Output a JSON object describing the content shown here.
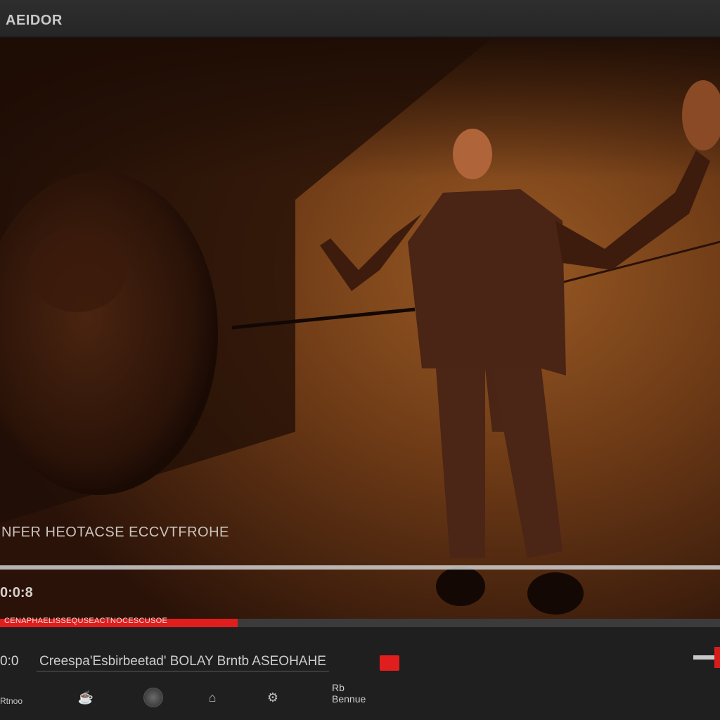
{
  "window": {
    "title": "AEIDOR"
  },
  "video": {
    "caption": "NFER HEOTACSE ECCVTFROHE",
    "elapsed": "0:0:8",
    "progress_percent": 33,
    "progress_label": "CENAPHAELISSEQUSEACTNOCESCUSOE"
  },
  "controls": {
    "left_label": "0:0",
    "title": "Creespa'Esbirbeetad' BOLAY Brntb ASEOHAHE",
    "bottom_label": "Rtnoo",
    "bottom_right_label": "Rb\nBennue",
    "icons": [
      "cup-icon",
      "circle-button-icon",
      "home-icon",
      "settings-icon"
    ],
    "accent_color": "#e01e1e"
  }
}
